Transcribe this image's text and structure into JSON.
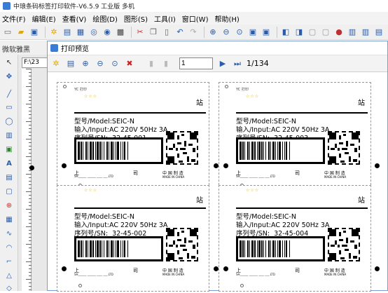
{
  "window": {
    "title": "中琅条码标签打印软件-V6.5.9 工业版 多机"
  },
  "menu": [
    "文件(F)",
    "编辑(E)",
    "查看(V)",
    "绘图(D)",
    "图形(S)",
    "工具(I)",
    "窗口(W)",
    "帮助(H)"
  ],
  "left_panel": {
    "label": "微软雅黑",
    "file_tab": "F:\\23"
  },
  "preview": {
    "title": "打印预览",
    "page_input": "1",
    "page_total": "1/134"
  },
  "labels": [
    {
      "top_text": "YC 打印",
      "stars": "☆☆☆",
      "station": "站",
      "model": "型号/Model:SEIC-N",
      "input": "输入/Input:AC 220V 50Hz 3A",
      "serial_prefix": "序列号/SN:",
      "serial": "32-45-001",
      "company": "上",
      "company_mid": "司",
      "company_en": "SH______ ______ ____ ___.LTD",
      "made_cn": "中 国 制 造",
      "made_en": "MADE IN CHINA"
    },
    {
      "top_text": "YC 打印",
      "stars": "☆☆☆",
      "station": "站",
      "model": "型号/Model:SEIC-N",
      "input": "输入/Input:AC 220V 50Hz 3A",
      "serial_prefix": "序列号/SN:",
      "serial": "32-45-003",
      "company": "上",
      "company_mid": "司",
      "company_en": "SH______ ______ ____ ___.LTD",
      "made_cn": "中 国 制 造",
      "made_en": "MADE IN CHINA"
    },
    {
      "top_text": "",
      "stars": "☆☆☆",
      "station": "站",
      "model": "型号/Model:SEIC-N",
      "input": "输入/Input:AC 220V 50Hz 3A",
      "serial_prefix": "序列号/SN:",
      "serial": "32-45-002",
      "company": "上",
      "company_mid": "司",
      "company_en": "SH______ ______ ____ ___.LTD",
      "made_cn": "中 国 制 造",
      "made_en": "MADE IN CHINA"
    },
    {
      "top_text": "",
      "stars": "☆☆☆",
      "station": "站",
      "model": "型号/Model:SEIC-N",
      "input": "输入/Input:AC 220V 50Hz 3A",
      "serial_prefix": "序列号/SN:",
      "serial": "32-45-004",
      "company": "上",
      "company_mid": "司",
      "company_en": "SH______ ______ ____ ___.LTD",
      "made_cn": "中 国 制 造",
      "made_en": "MADE IN CHINA"
    }
  ],
  "colors": {
    "accent": "#3a7bd5",
    "border": "#7a9cd3"
  }
}
